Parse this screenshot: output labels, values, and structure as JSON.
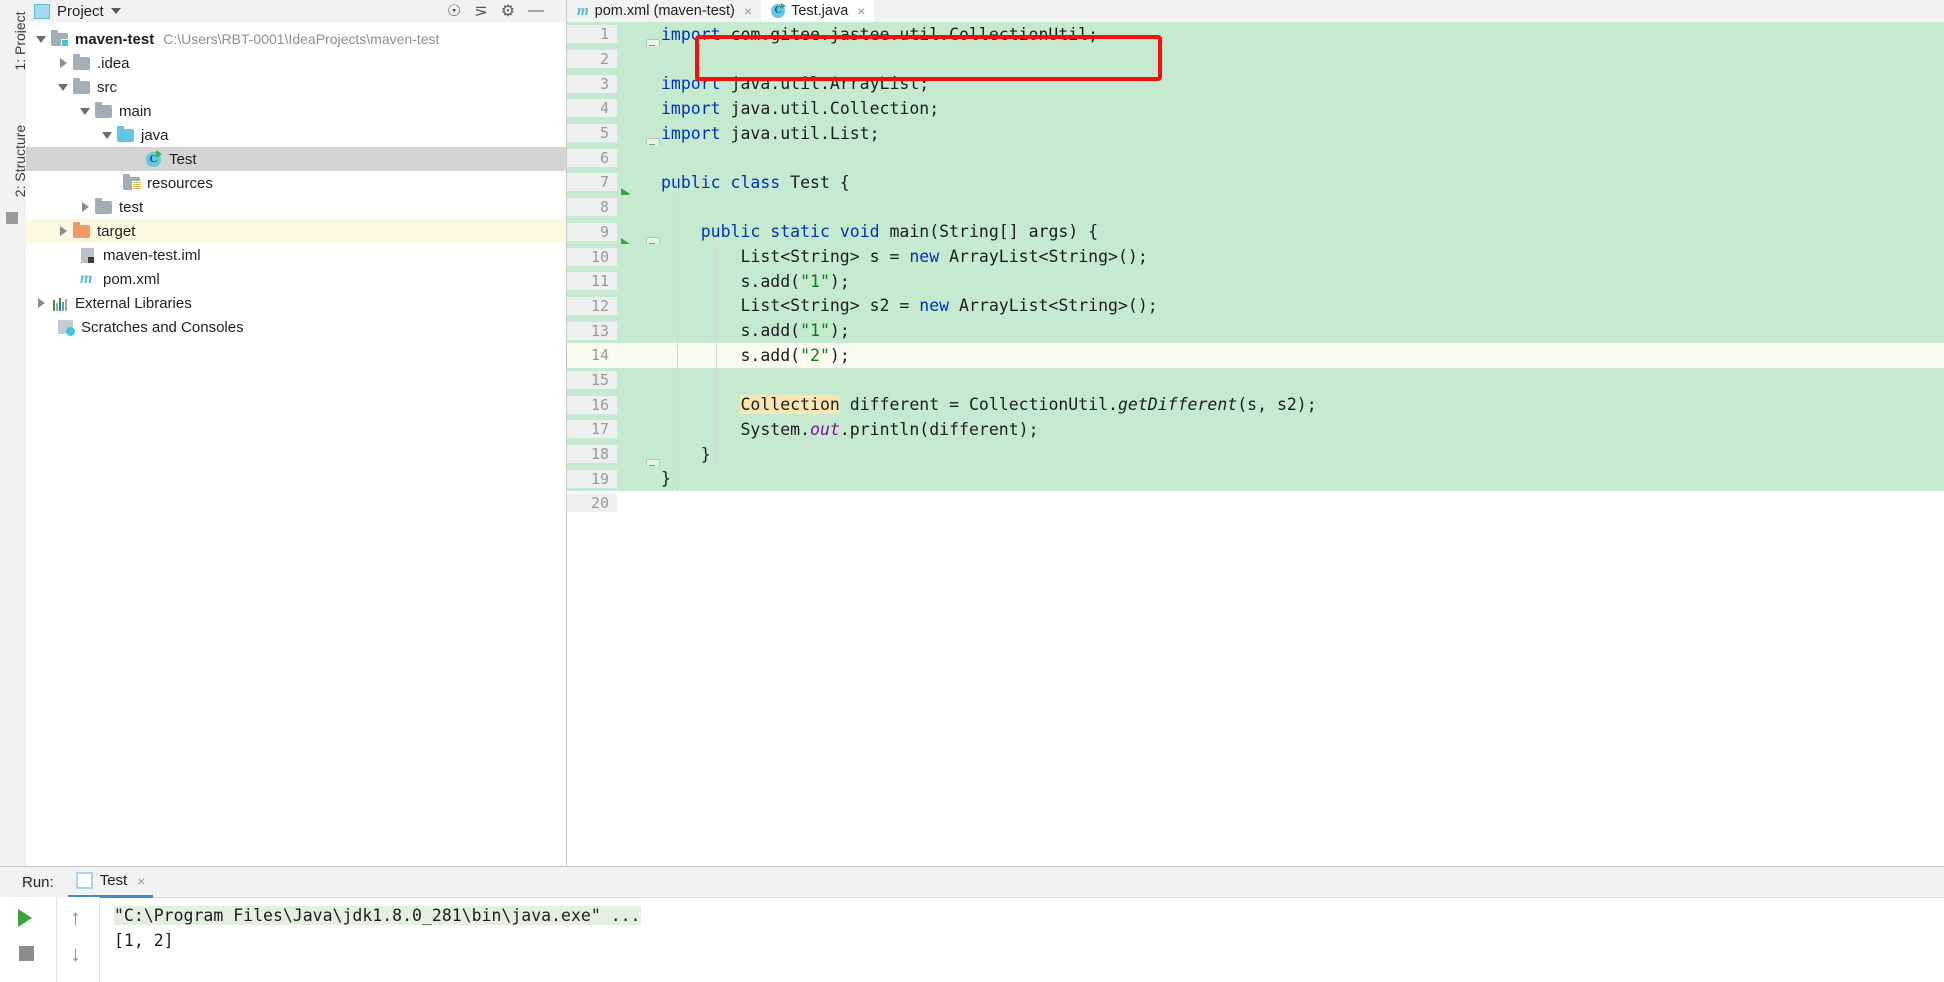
{
  "app": "IntelliJ IDEA",
  "left_strip": {
    "project_tab": "1: Project",
    "structure_tab": "2: Structure"
  },
  "project_panel": {
    "title": "Project",
    "tree": [
      {
        "label": "maven-test",
        "path": "C:\\Users\\RBT-0001\\IdeaProjects\\maven-test",
        "icon": "module-folder-icon",
        "arrow": "open",
        "indent": 0,
        "bold": true,
        "state": "normal"
      },
      {
        "label": ".idea",
        "path": "",
        "icon": "folder-icon",
        "arrow": "closed",
        "indent": 1,
        "bold": false,
        "state": "normal"
      },
      {
        "label": "src",
        "path": "",
        "icon": "folder-icon",
        "arrow": "open",
        "indent": 1,
        "bold": false,
        "state": "normal"
      },
      {
        "label": "main",
        "path": "",
        "icon": "folder-icon",
        "arrow": "open",
        "indent": 2,
        "bold": false,
        "state": "normal"
      },
      {
        "label": "java",
        "path": "",
        "icon": "source-folder-icon",
        "arrow": "open",
        "indent": 3,
        "bold": false,
        "state": "normal"
      },
      {
        "label": "Test",
        "path": "",
        "icon": "java-class-icon",
        "arrow": "none",
        "indent": 5,
        "bold": false,
        "state": "selected"
      },
      {
        "label": "resources",
        "path": "",
        "icon": "resources-folder-icon",
        "arrow": "none",
        "indent": 4,
        "bold": false,
        "state": "normal"
      },
      {
        "label": "test",
        "path": "",
        "icon": "folder-icon",
        "arrow": "closed",
        "indent": 2,
        "bold": false,
        "state": "normal"
      },
      {
        "label": "target",
        "path": "",
        "icon": "excluded-folder-icon",
        "arrow": "closed",
        "indent": 1,
        "bold": false,
        "state": "tinted"
      },
      {
        "label": "maven-test.iml",
        "path": "",
        "icon": "iml-file-icon",
        "arrow": "none",
        "indent": 2,
        "bold": false,
        "state": "normal"
      },
      {
        "label": "pom.xml",
        "path": "",
        "icon": "maven-pom-icon",
        "arrow": "none",
        "indent": 2,
        "bold": false,
        "state": "normal"
      },
      {
        "label": "External Libraries",
        "path": "",
        "icon": "libraries-icon",
        "arrow": "closed",
        "indent": 0,
        "bold": false,
        "state": "normal"
      },
      {
        "label": "Scratches and Consoles",
        "path": "",
        "icon": "scratches-icon",
        "arrow": "none",
        "indent": 1,
        "bold": false,
        "state": "normal"
      }
    ]
  },
  "editor": {
    "tabs": [
      {
        "label": "pom.xml (maven-test)",
        "icon": "maven-pom-icon",
        "active": false,
        "close": "×"
      },
      {
        "label": "Test.java",
        "icon": "java-class-icon",
        "active": true,
        "close": "×"
      }
    ],
    "toolbar_icons": [
      "globe-icon",
      "collapse-all-icon",
      "settings-gear-icon",
      "hide-panel-icon"
    ],
    "annotation": {
      "type": "red-rectangle",
      "color": "#fb0d0d",
      "targets_line": 1
    },
    "lines": [
      {
        "n": "1",
        "bg": "green",
        "fold": "collapse",
        "run": false,
        "tokens": [
          {
            "t": "import ",
            "c": "kw"
          },
          {
            "t": "com.gitee.jastee.util.CollectionUtil;",
            "c": "plain"
          }
        ]
      },
      {
        "n": "2",
        "bg": "green",
        "fold": "none",
        "run": false,
        "tokens": []
      },
      {
        "n": "3",
        "bg": "green",
        "fold": "none",
        "run": false,
        "tokens": [
          {
            "t": "import ",
            "c": "kw"
          },
          {
            "t": "java.util.ArrayList;",
            "c": "plain"
          }
        ]
      },
      {
        "n": "4",
        "bg": "green",
        "fold": "none",
        "run": false,
        "tokens": [
          {
            "t": "import ",
            "c": "kw"
          },
          {
            "t": "java.util.Collection;",
            "c": "plain"
          }
        ]
      },
      {
        "n": "5",
        "bg": "green",
        "fold": "collapse",
        "run": false,
        "tokens": [
          {
            "t": "import ",
            "c": "kw"
          },
          {
            "t": "java.util.List;",
            "c": "plain"
          }
        ]
      },
      {
        "n": "6",
        "bg": "green",
        "fold": "none",
        "run": false,
        "tokens": []
      },
      {
        "n": "7",
        "bg": "green",
        "fold": "none",
        "run": true,
        "tokens": [
          {
            "t": "public class ",
            "c": "kw"
          },
          {
            "t": "Test {",
            "c": "plain"
          }
        ]
      },
      {
        "n": "8",
        "bg": "green",
        "fold": "none",
        "run": false,
        "tokens": []
      },
      {
        "n": "9",
        "bg": "green",
        "fold": "collapse",
        "run": true,
        "tokens": [
          {
            "t": "    ",
            "c": "plain"
          },
          {
            "t": "public static void ",
            "c": "kw"
          },
          {
            "t": "main(String[] args) {",
            "c": "plain"
          }
        ]
      },
      {
        "n": "10",
        "bg": "green",
        "fold": "none",
        "run": false,
        "tokens": [
          {
            "t": "        List<String> s = ",
            "c": "plain"
          },
          {
            "t": "new ",
            "c": "kw"
          },
          {
            "t": "ArrayList<String>();",
            "c": "plain"
          }
        ]
      },
      {
        "n": "11",
        "bg": "green",
        "fold": "none",
        "run": false,
        "tokens": [
          {
            "t": "        s.add(",
            "c": "plain"
          },
          {
            "t": "\"1\"",
            "c": "str"
          },
          {
            "t": ");",
            "c": "plain"
          }
        ]
      },
      {
        "n": "12",
        "bg": "green",
        "fold": "none",
        "run": false,
        "tokens": [
          {
            "t": "        List<String> s2 = ",
            "c": "plain"
          },
          {
            "t": "new ",
            "c": "kw"
          },
          {
            "t": "ArrayList<String>();",
            "c": "plain"
          }
        ]
      },
      {
        "n": "13",
        "bg": "green",
        "fold": "none",
        "run": false,
        "tokens": [
          {
            "t": "        s.add(",
            "c": "plain"
          },
          {
            "t": "\"1\"",
            "c": "str"
          },
          {
            "t": ");",
            "c": "plain"
          }
        ]
      },
      {
        "n": "14",
        "bg": "caret",
        "fold": "none",
        "run": false,
        "tokens": [
          {
            "t": "        s.add(",
            "c": "plain"
          },
          {
            "t": "\"2\"",
            "c": "str"
          },
          {
            "t": ");",
            "c": "plain"
          }
        ]
      },
      {
        "n": "15",
        "bg": "green",
        "fold": "none",
        "run": false,
        "tokens": []
      },
      {
        "n": "16",
        "bg": "green",
        "fold": "none",
        "run": false,
        "tokens": [
          {
            "t": "        ",
            "c": "plain"
          },
          {
            "t": "Collection",
            "c": "hl-ident"
          },
          {
            "t": " different = CollectionUtil.",
            "c": "plain"
          },
          {
            "t": "getDifferent",
            "c": "stat"
          },
          {
            "t": "(s, s2);",
            "c": "plain"
          }
        ]
      },
      {
        "n": "17",
        "bg": "green",
        "fold": "none",
        "run": false,
        "tokens": [
          {
            "t": "        System.",
            "c": "plain"
          },
          {
            "t": "out",
            "c": "fld"
          },
          {
            "t": ".println(different);",
            "c": "plain"
          }
        ]
      },
      {
        "n": "18",
        "bg": "green",
        "fold": "collapse",
        "run": false,
        "tokens": [
          {
            "t": "    }",
            "c": "plain"
          }
        ]
      },
      {
        "n": "19",
        "bg": "green",
        "fold": "none",
        "run": false,
        "tokens": [
          {
            "t": "}",
            "c": "plain"
          }
        ]
      },
      {
        "n": "20",
        "bg": "white",
        "fold": "none",
        "run": false,
        "tokens": []
      }
    ]
  },
  "run_panel": {
    "label": "Run:",
    "tab": "Test",
    "tab_close": "×",
    "buttons": [
      "rerun-play-button",
      "scroll-up-button",
      "stop-button",
      "scroll-down-button"
    ],
    "output": [
      {
        "text": "\"C:\\Program Files\\Java\\jdk1.8.0_281\\bin\\java.exe\" ...",
        "highlight": true
      },
      {
        "text": "[1, 2]",
        "highlight": false
      }
    ]
  },
  "colors": {
    "changed_line_bg": "#c5ead0",
    "caret_line_bg": "#fbfaef",
    "selection_bg": "#d4d4d4",
    "annotation_red": "#fb0d0d",
    "keyword_blue": "#0033b3",
    "string_green": "#067d17",
    "field_purple": "#871094",
    "identifier_highlight": "#fbe6b2"
  }
}
